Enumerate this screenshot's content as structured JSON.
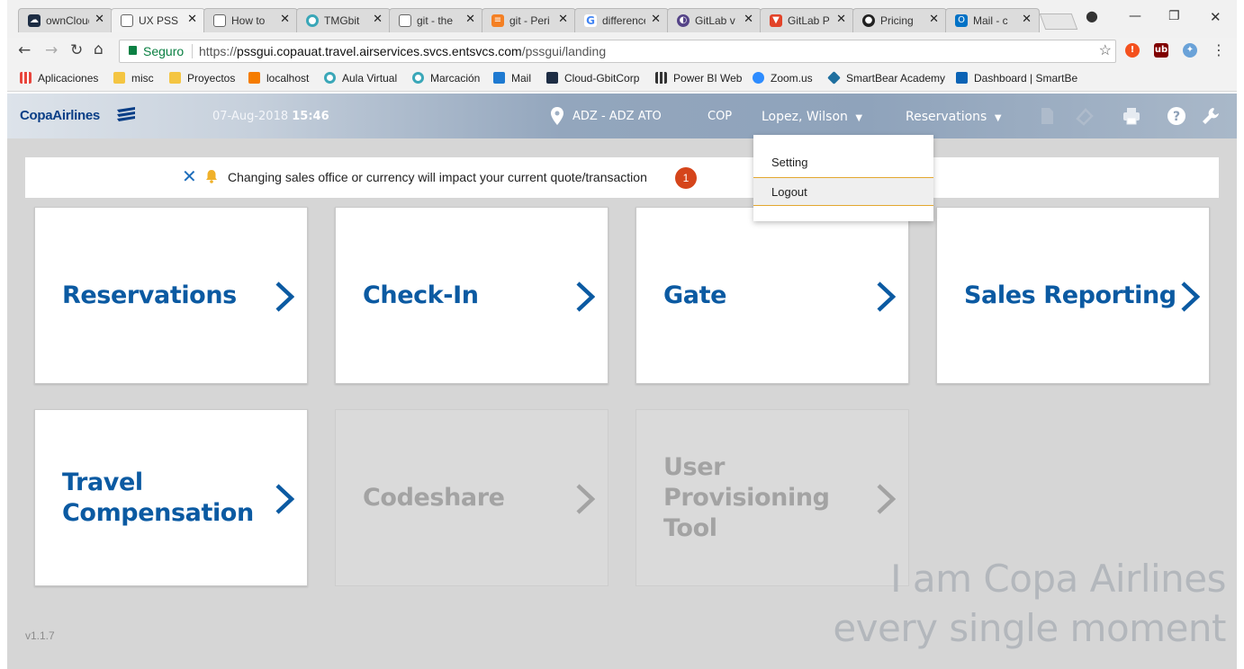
{
  "browser": {
    "tabs": [
      {
        "title": "ownCloud",
        "favicon": "cloud-icon",
        "color": "#1d2d44"
      },
      {
        "title": "UX PSS Gui",
        "favicon": "page-icon",
        "color": "#ffffff"
      },
      {
        "title": "How to",
        "favicon": "page-icon",
        "color": "#ffffff"
      },
      {
        "title": "TMGbit",
        "favicon": "circle-icon",
        "color": "#3aa7b8"
      },
      {
        "title": "git - the",
        "favicon": "page-icon",
        "color": "#ffffff"
      },
      {
        "title": "git - Peri",
        "favicon": "stackoverflow-icon",
        "color": "#f48024"
      },
      {
        "title": "difference",
        "favicon": "google-icon",
        "color": "#4285f4"
      },
      {
        "title": "GitLab v",
        "favicon": "gitlab-circle-icon",
        "color": "#554488"
      },
      {
        "title": "GitLab P",
        "favicon": "gitlab-icon",
        "color": "#e24329"
      },
      {
        "title": "Pricing",
        "favicon": "github-icon",
        "color": "#222222"
      },
      {
        "title": "Mail - c",
        "favicon": "outlook-icon",
        "color": "#0072c6"
      }
    ],
    "secure_label": "Seguro",
    "url_prefix": "https://",
    "url_host": "pssgui.copauat.travel.airservices.svcs.entsvcs.com",
    "url_path": "/pssgui/landing",
    "bookmarks": [
      {
        "label": "Aplicaciones",
        "icon": "apps-icon",
        "color": "#e8453c"
      },
      {
        "label": "misc",
        "icon": "folder-icon",
        "color": "#f4c542"
      },
      {
        "label": "Proyectos",
        "icon": "folder-icon",
        "color": "#f4c542"
      },
      {
        "label": "localhost",
        "icon": "xampp-icon",
        "color": "#f57c00"
      },
      {
        "label": "Aula Virtual",
        "icon": "circle-icon",
        "color": "#3aa7b8"
      },
      {
        "label": "Marcación",
        "icon": "circle-icon",
        "color": "#3aa7b8"
      },
      {
        "label": "Mail",
        "icon": "zimbra-icon",
        "color": "#1e7ad1"
      },
      {
        "label": "Cloud-GbitCorp",
        "icon": "cloud-icon",
        "color": "#1d2d44"
      },
      {
        "label": "Power BI Web",
        "icon": "powerbi-icon",
        "color": "#333333"
      },
      {
        "label": "Zoom.us",
        "icon": "zoom-icon",
        "color": "#2d8cff"
      },
      {
        "label": "SmartBear Academy",
        "icon": "smartbear-icon",
        "color": "#1f6f9f"
      },
      {
        "label": "Dashboard | SmartBe",
        "icon": "dashboard-icon",
        "color": "#0b63b5"
      }
    ]
  },
  "header": {
    "logo": "CopaAirlines",
    "date": "07-Aug-2018",
    "time": "15:46",
    "office": "ADZ - ADZ ATO",
    "currency": "COP",
    "user": "Lopez, Wilson",
    "module": "Reservations",
    "dropdown_arrow": "▼"
  },
  "dropdown": {
    "items": [
      "Setting",
      "Logout"
    ]
  },
  "notice": {
    "close": "✕",
    "message": "Changing sales office or currency will impact your current quote/transaction",
    "badge": "1"
  },
  "tiles": [
    {
      "label": "Reservations",
      "enabled": true
    },
    {
      "label": "Check-In",
      "enabled": true
    },
    {
      "label": "Gate",
      "enabled": true
    },
    {
      "label": "Sales Reporting",
      "enabled": true
    },
    {
      "label": "Travel Compensation",
      "enabled": true
    },
    {
      "label": "Codeshare",
      "enabled": false
    },
    {
      "label": "User Provisioning Tool",
      "enabled": false
    }
  ],
  "version": "v1.1.7",
  "slogan": {
    "line1": "I am Copa Airlines",
    "line2": "every single moment"
  },
  "colors": {
    "brand_blue": "#0b5aa2",
    "badge": "#d5451b",
    "highlight": "#e3a72f"
  }
}
